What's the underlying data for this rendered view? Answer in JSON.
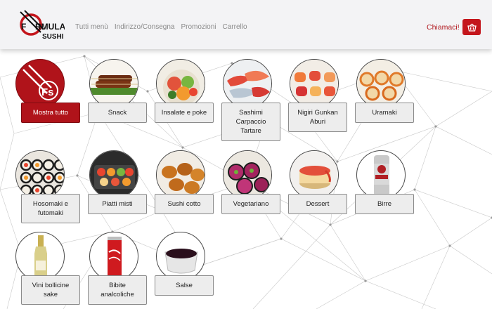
{
  "header": {
    "logo_text": "FORMULA SUSHI",
    "nav": [
      "Tutti menù",
      "Indirizzo/Consegna",
      "Promozioni",
      "Carrello"
    ],
    "call_label": "Chiamaci!",
    "cart_icon": "basket-icon"
  },
  "colors": {
    "brand": "#b0131a",
    "nav_text": "#8a8a8a",
    "label_bg": "#ededed"
  },
  "categories": [
    {
      "label": "Mostra tutto",
      "image": "fs-logo",
      "active": true
    },
    {
      "label": "Snack",
      "image": "skewers"
    },
    {
      "label": "Insalate e poke",
      "image": "poke-salad"
    },
    {
      "label": "Sashimi\nCarpaccio\nTartare",
      "image": "sashimi"
    },
    {
      "label": "Nigiri Gunkan\nAburi",
      "image": "nigiri"
    },
    {
      "label": "Uramaki",
      "image": "uramaki"
    },
    {
      "label": "Hosomaki e\nfutomaki",
      "image": "hosomaki"
    },
    {
      "label": "Piatti misti",
      "image": "mixed-platter"
    },
    {
      "label": "Sushi cotto",
      "image": "cooked-sushi"
    },
    {
      "label": "Vegetariano",
      "image": "veggie-rolls"
    },
    {
      "label": "Dessert",
      "image": "cheesecake"
    },
    {
      "label": "Birre",
      "image": "beer-can"
    },
    {
      "label": "Vini bollicine\nsake",
      "image": "wine-bottle"
    },
    {
      "label": "Bibite\nanalcoliche",
      "image": "cola-can"
    },
    {
      "label": "Salse",
      "image": "soy-sauce"
    }
  ]
}
